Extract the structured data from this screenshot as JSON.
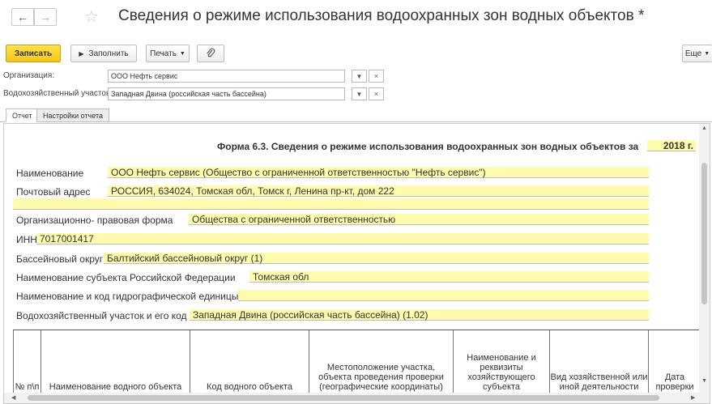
{
  "window": {
    "title": "Сведения о режиме использования водоохранных зон водных объектов *"
  },
  "toolbar": {
    "save_label": "Записать",
    "fill_label": "Заполнить",
    "print_label": "Печать",
    "more_label": "Еще"
  },
  "fields": {
    "organization": {
      "label": "Организация:",
      "value": "ООО Нефть сервис"
    },
    "water_area": {
      "label": "Водохозяйственный участок:",
      "value": "Западная Двина (российская часть бассейна)"
    }
  },
  "tabs": [
    {
      "label": "Отчет",
      "active": true
    },
    {
      "label": "Настройки отчета",
      "active": false
    }
  ],
  "report": {
    "form_title": "Форма 6.3. Сведения о режиме использования водоохранных зон водных объектов за",
    "year": "2018 г.",
    "name_label": "Наименование",
    "name_value": "ООО Нефть сервис (Общество с ограниченной ответственностью \"Нефть сервис\")",
    "address_label": "Почтовый адрес",
    "address_value": "РОССИЯ, 634024, Томская обл, Томск г, Ленина пр-кт, дом 222",
    "legal_form_label": "Организационно- правовая форма",
    "legal_form_value": "Общества с ограниченной ответственностью",
    "inn_label": "ИНН",
    "inn_value": "7017001417",
    "basin_label": "Бассейновый округ",
    "basin_value": "Балтийский бассейновый округ (1)",
    "subject_label": "Наименование субъекта Российской Федерации",
    "subject_value": "Томская обл",
    "hydro_label": "Наименование и код гидрографической единицы",
    "hydro_value": "",
    "wsection_label": "Водохозяйственный участок и его код",
    "wsection_value": "Западная Двина (российская часть бассейна) (1.02)",
    "columns": [
      "№ п\\п",
      "Наименование водного объекта",
      "Код водного объекта",
      "Местоположение участка, объекта проведения проверки (географические координаты)",
      "Наименование и реквизиты хозяйствующего субъекта",
      "Вид хозяйственной или иной деятельности",
      "Дата проверки"
    ]
  },
  "colors": {
    "save_button": "#f4c61a",
    "field_highlight": "#fffbae"
  }
}
